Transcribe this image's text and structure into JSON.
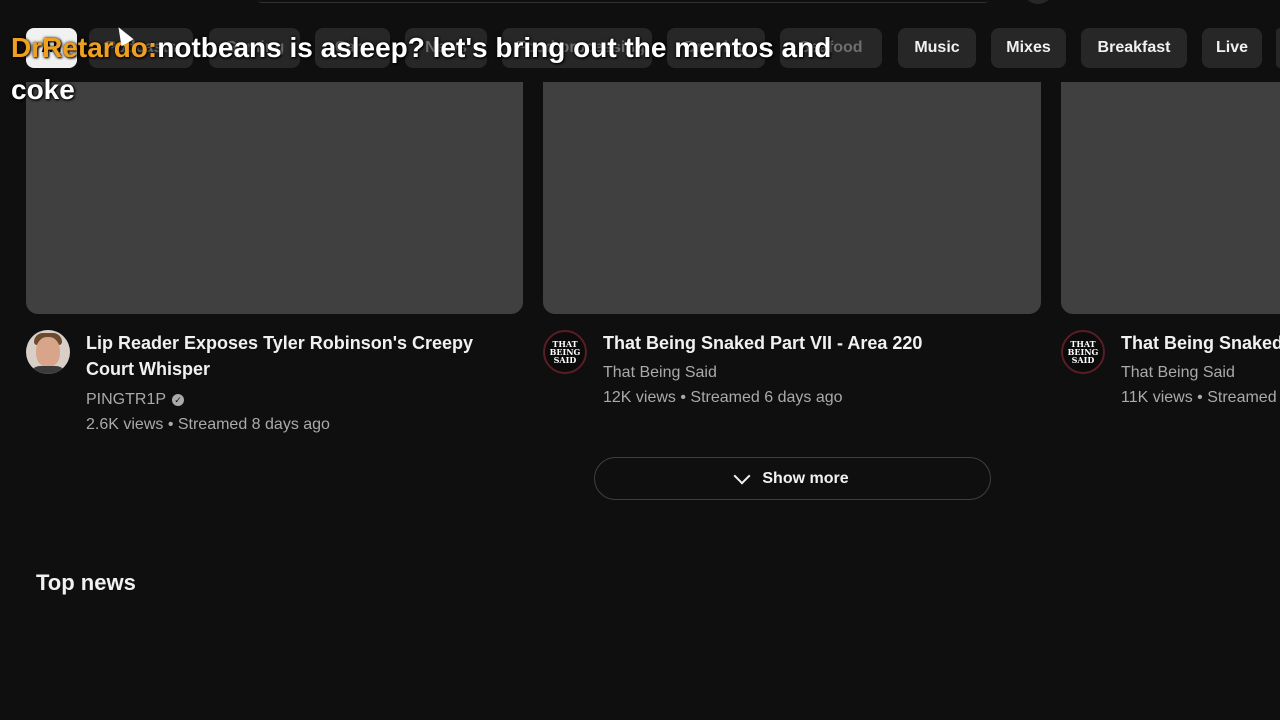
{
  "chips": [
    {
      "label": "All",
      "active": true
    },
    {
      "label": "Podcasts",
      "active": false
    },
    {
      "label": "Gaming",
      "active": false
    },
    {
      "label": "Cars",
      "active": false
    },
    {
      "label": "News",
      "active": false
    },
    {
      "label": "Food processing",
      "active": false
    },
    {
      "label": "Drawing",
      "active": false
    },
    {
      "label": "Seafood",
      "active": false
    },
    {
      "label": "Music",
      "active": false
    },
    {
      "label": "Mixes",
      "active": false
    },
    {
      "label": "Breakfast",
      "active": false
    },
    {
      "label": "Live",
      "active": false
    }
  ],
  "chat": {
    "username": "DrRetardo:",
    "message": "notbeans is asleep? let's bring out the mentos and coke"
  },
  "videos": [
    {
      "title": "Lip Reader Exposes Tyler Robinson's Creepy Court Whisper",
      "channel": "PINGTR1P",
      "verified": true,
      "stats": "2.6K views • Streamed 8 days ago",
      "avatar": "person-avatar"
    },
    {
      "title": "That Being Snaked Part VII - Area 220",
      "channel": "That Being Said",
      "verified": false,
      "stats": "12K views • Streamed 6 days ago",
      "avatar": "that-being-said-logo",
      "logo_text": "THAT BEING SAID"
    },
    {
      "title": "That Being Snaked",
      "channel": "That Being Said",
      "verified": false,
      "stats": "11K views • Streamed",
      "avatar": "that-being-said-logo",
      "logo_text": "THAT BEING SAID"
    }
  ],
  "show_more": {
    "label": "Show more",
    "icon": "chevron-down-icon"
  },
  "sections": {
    "top_news": "Top news"
  }
}
